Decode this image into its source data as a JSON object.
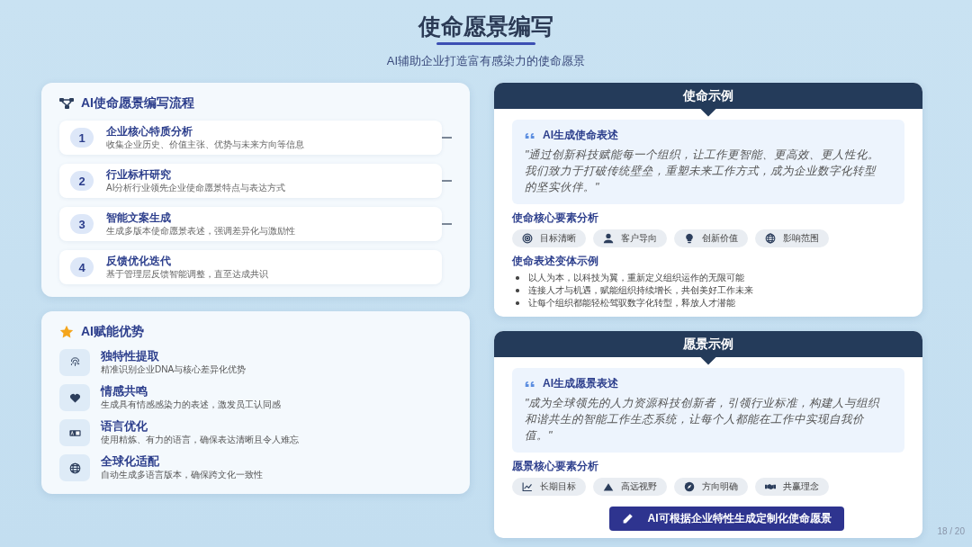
{
  "title": "使命愿景编写",
  "subtitle": "AI辅助企业打造富有感染力的使命愿景",
  "process": {
    "title": "AI使命愿景编写流程",
    "steps": [
      {
        "number": "1",
        "title": "企业核心特质分析",
        "description": "收集企业历史、价值主张、优势与未来方向等信息",
        "connector": true
      },
      {
        "number": "2",
        "title": "行业标杆研究",
        "description": "AI分析行业领先企业使命愿景特点与表达方式",
        "connector": true
      },
      {
        "number": "3",
        "title": "智能文案生成",
        "description": "生成多版本使命愿景表述，强调差异化与激励性",
        "connector": true
      },
      {
        "number": "4",
        "title": "反馈优化迭代",
        "description": "基于管理层反馈智能调整，直至达成共识",
        "connector": false
      }
    ]
  },
  "advantages": {
    "title": "AI赋能优势",
    "items": [
      {
        "title": "独特性提取",
        "description": "精准识别企业DNA与核心差异化优势"
      },
      {
        "title": "情感共鸣",
        "description": "生成具有情感感染力的表述，激发员工认同感"
      },
      {
        "title": "语言优化",
        "description": "使用精炼、有力的语言，确保表达清晰且令人难忘"
      },
      {
        "title": "全球化适配",
        "description": "自动生成多语言版本，确保跨文化一致性"
      }
    ]
  },
  "mission": {
    "header": "使命示例",
    "quote_title": "AI生成使命表述",
    "quote": "\"通过创新科技赋能每一个组织，让工作更智能、更高效、更人性化。我们致力于打破传统壁垒，重塑未来工作方式，成为企业数字化转型的坚实伙伴。\"",
    "analysis_title": "使命核心要素分析",
    "tags": [
      "目标清晰",
      "客户导向",
      "创新价值",
      "影响范围"
    ],
    "variants_title": "使命表述变体示例",
    "variants": [
      "以人为本，以科技为翼，重新定义组织运作的无限可能",
      "连接人才与机遇，赋能组织持续增长，共创美好工作未来",
      "让每个组织都能轻松驾驭数字化转型，释放人才潜能"
    ]
  },
  "vision": {
    "header": "愿景示例",
    "quote_title": "AI生成愿景表述",
    "quote": "\"成为全球领先的人力资源科技创新者，引领行业标准，构建人与组织和谐共生的智能工作生态系统，让每个人都能在工作中实现自我价值。\"",
    "analysis_title": "愿景核心要素分析",
    "tags": [
      "长期目标",
      "高远视野",
      "方向明确",
      "共赢理念"
    ]
  },
  "action_button": "AI可根据企业特性生成定制化使命愿景",
  "page_number": "18 / 20"
}
